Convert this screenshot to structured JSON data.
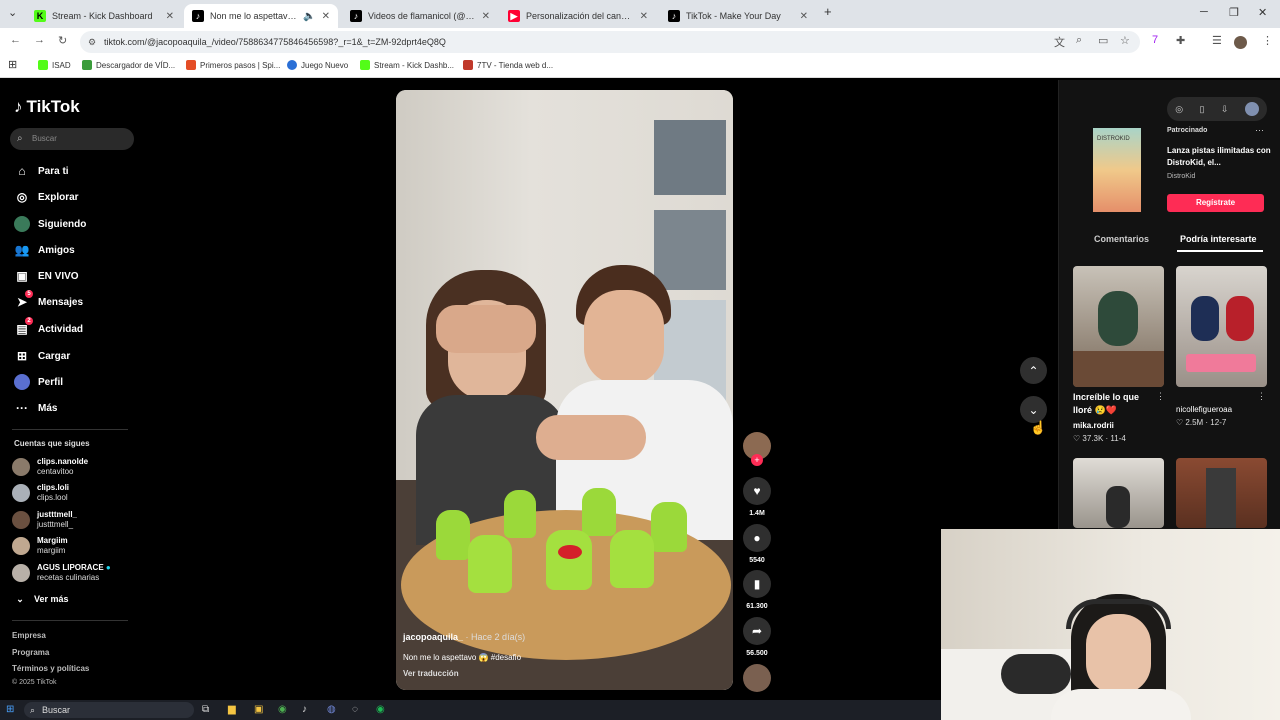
{
  "browser": {
    "tabs": [
      {
        "label": "Stream - Kick Dashboard",
        "icon": "kick-icon",
        "color": "#53fc18"
      },
      {
        "label": "Non me lo aspettavo😱 #d",
        "icon": "tiktok-icon",
        "color": "#000000",
        "active": true
      },
      {
        "label": "Videos de flamanicol (@flamani",
        "icon": "tiktok-icon",
        "color": "#000000"
      },
      {
        "label": "Personalización del canal - You",
        "icon": "youtube-icon",
        "color": "#ff0033"
      },
      {
        "label": "TikTok - Make Your Day",
        "icon": "tiktok-icon",
        "color": "#000000"
      }
    ],
    "new_tab": "+",
    "url": "tiktok.com/@jacopoaquila_/video/7588634775846456598?_r=1&_t=ZM-92dprt4eQ8Q",
    "bookmarks": [
      {
        "label": "ISAD",
        "color": "#53fc18"
      },
      {
        "label": "Descargador de VÍD...",
        "color": "#3b9c3b"
      },
      {
        "label": "Primeros pasos | Spi...",
        "color": "#e44d26"
      },
      {
        "label": "Juego Nuevo",
        "color": "#2a6fd6"
      },
      {
        "label": "Stream - Kick Dashb...",
        "color": "#53fc18"
      },
      {
        "label": "7TV - Tienda web d...",
        "color": "#c0392b"
      }
    ]
  },
  "sidebar": {
    "logo": "TikTok",
    "search_placeholder": "Buscar",
    "nav": [
      {
        "label": "Para ti",
        "icon": "home-icon"
      },
      {
        "label": "Explorar",
        "icon": "compass-icon"
      },
      {
        "label": "Siguiendo",
        "icon": "following-avatar-icon"
      },
      {
        "label": "Amigos",
        "icon": "friends-icon"
      },
      {
        "label": "EN VIVO",
        "icon": "live-icon"
      },
      {
        "label": "Mensajes",
        "icon": "send-icon",
        "badge": "5"
      },
      {
        "label": "Actividad",
        "icon": "message-icon",
        "badge": "2"
      },
      {
        "label": "Cargar",
        "icon": "upload-icon"
      },
      {
        "label": "Perfil",
        "icon": "profile-avatar-icon"
      },
      {
        "label": "Más",
        "icon": "more-icon"
      }
    ],
    "following_heading": "Cuentas que sigues",
    "following": [
      {
        "name": "clips.nanolde",
        "sub": "centavitoo"
      },
      {
        "name": "clips.loli",
        "sub": "clips.lool"
      },
      {
        "name": "justttmell_",
        "sub": "justttmell_"
      },
      {
        "name": "Margiim",
        "sub": "margiim"
      },
      {
        "name": "AGUS LIPORACE",
        "sub": "recetas culinarias",
        "verified": true
      }
    ],
    "see_more": "Ver más",
    "footer": [
      "Empresa",
      "Programa",
      "Términos y políticas",
      "© 2025 TikTok"
    ]
  },
  "video": {
    "author": "jacopoaquila_",
    "posted": "· Hace 2 día(s)",
    "caption": "Non me lo aspettavo 😱 #desafio",
    "translate": "Ver traducción"
  },
  "actions": {
    "likes": "1.4M",
    "comments": "5540",
    "saves": "61.300",
    "shares": "56.500"
  },
  "rightpanel": {
    "ad_label": "Patrocinado",
    "ad_title": "Lanza pistas ilimitadas con DistroKid, el...",
    "ad_brand": "DistroKid",
    "ad_thumb_text": "DISTROKID",
    "ad_cta": "Regístrate",
    "tabs": [
      "Comentarios",
      "Podría interesarte"
    ],
    "recs": [
      {
        "title": "Increíble lo que lloré 😢❤️",
        "user": "mika.rodrii",
        "meta": "♡ 37.3K · 11-4"
      },
      {
        "title": "",
        "user": "nicollefigueroaa",
        "meta": "♡ 2.5M · 12-7"
      }
    ]
  },
  "taskbar": {
    "search_label": "Buscar"
  }
}
